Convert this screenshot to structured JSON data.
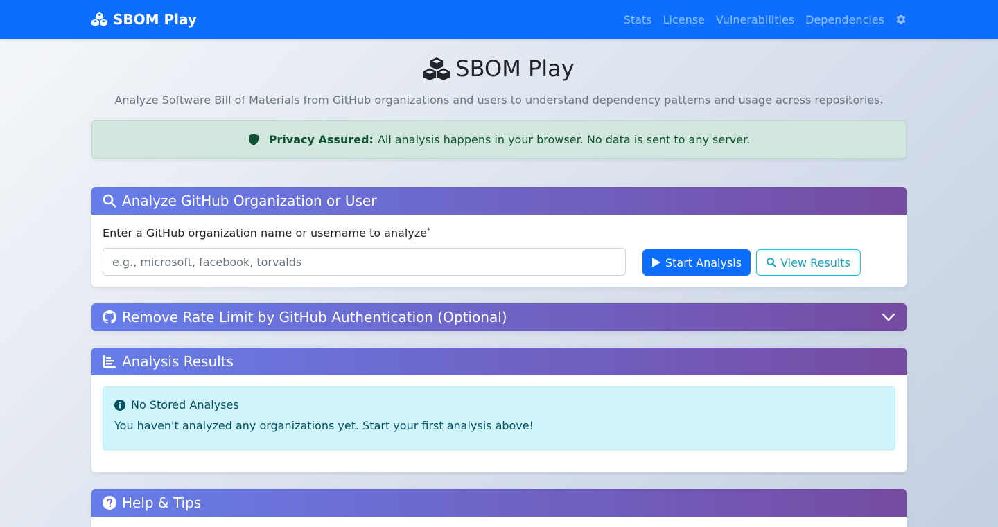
{
  "navbar": {
    "brand": "SBOM Play",
    "brand_icon": "cubes-icon",
    "links": [
      "Stats",
      "License",
      "Vulnerabilities",
      "Dependencies"
    ],
    "settings_icon": "gear-icon"
  },
  "hero": {
    "title": "SBOM Play",
    "subtitle": "Analyze Software Bill of Materials from GitHub organizations and users to understand dependency patterns and usage across repositories."
  },
  "privacy": {
    "label": "Privacy Assured:",
    "text": "All analysis happens in your browser. No data is sent to any server."
  },
  "analyze": {
    "header": "Analyze GitHub Organization or User",
    "field_label": "Enter a GitHub organization name or username to analyze",
    "required_mark": "*",
    "placeholder": "e.g., microsoft, facebook, torvalds",
    "value": "",
    "start_label": "Start Analysis",
    "view_label": "View Results"
  },
  "auth": {
    "header": "Remove Rate Limit by GitHub Authentication (Optional)"
  },
  "results": {
    "header": "Analysis Results",
    "info_title": "No Stored Analyses",
    "info_text": "You haven't analyzed any organizations yet. Start your first analysis above!"
  },
  "help": {
    "header": "Help & Tips"
  },
  "colors": {
    "navbar": "#0d6efd",
    "header_gradient_start": "#667eea",
    "header_gradient_end": "#764ba2",
    "privacy_bg": "#d1e7dd",
    "info_bg": "#cff4fc"
  }
}
